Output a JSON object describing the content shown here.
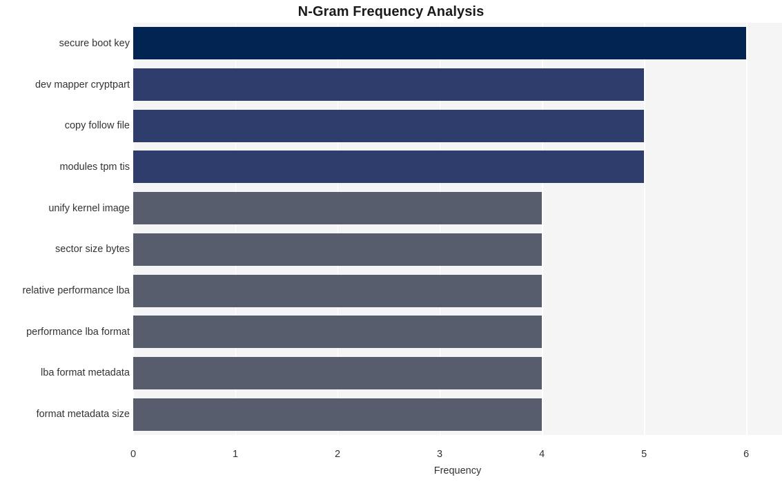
{
  "chart_data": {
    "type": "bar",
    "orientation": "horizontal",
    "title": "N-Gram Frequency Analysis",
    "xlabel": "Frequency",
    "ylabel": "",
    "xlim": [
      0,
      6.35
    ],
    "xticks": [
      0,
      1,
      2,
      3,
      4,
      5,
      6
    ],
    "xtick_labels": [
      "0",
      "1",
      "2",
      "3",
      "4",
      "5",
      "6"
    ],
    "grid": "vertical-white",
    "legend": null,
    "categories": [
      "secure boot key",
      "dev mapper cryptpart",
      "copy follow file",
      "modules tpm tis",
      "unify kernel image",
      "sector size bytes",
      "relative performance lba",
      "performance lba format",
      "lba format metadata",
      "format metadata size"
    ],
    "values": [
      6,
      5,
      5,
      5,
      4,
      4,
      4,
      4,
      4,
      4
    ],
    "bar_colors": [
      "#022452",
      "#2e3d6b",
      "#2e3d6b",
      "#2e3d6b",
      "#585d6e",
      "#585d6e",
      "#585d6e",
      "#585d6e",
      "#585d6e",
      "#585d6e"
    ],
    "plot_background": "#f5f5f6",
    "figure_background": "#ffffff",
    "gridline_color": "#ffffff"
  }
}
